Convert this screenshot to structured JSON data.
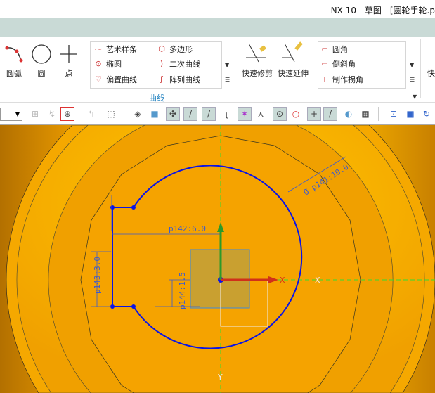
{
  "window": {
    "title": "NX 10 - 草图 - [圆轮手轮.p"
  },
  "ribbon": {
    "big_tools": [
      {
        "label": "圆弧"
      },
      {
        "label": "圆"
      },
      {
        "label": "点"
      }
    ],
    "curve_group": {
      "items": [
        "艺术样条",
        "多边形",
        "椭圆",
        "二次曲线",
        "偏置曲线",
        "阵列曲线"
      ],
      "label": "曲线"
    },
    "edit_tools": [
      {
        "label": "快速修剪"
      },
      {
        "label": "快速延伸"
      }
    ],
    "corner_group": {
      "items": [
        "圆角",
        "倒斜角",
        "制作拐角"
      ]
    },
    "cut_label": "快"
  },
  "sketch": {
    "dims": {
      "diameter": "Ø p141:10.0",
      "horizontal": "p142:6.0",
      "vertical": "p143:3.0",
      "offset": "p144:1.5"
    },
    "axes": {
      "x": "X",
      "y": "Y"
    },
    "colors": {
      "sketch": "#0a14e6",
      "face": "#f5a300",
      "dimension": "#3a5ad0"
    }
  }
}
